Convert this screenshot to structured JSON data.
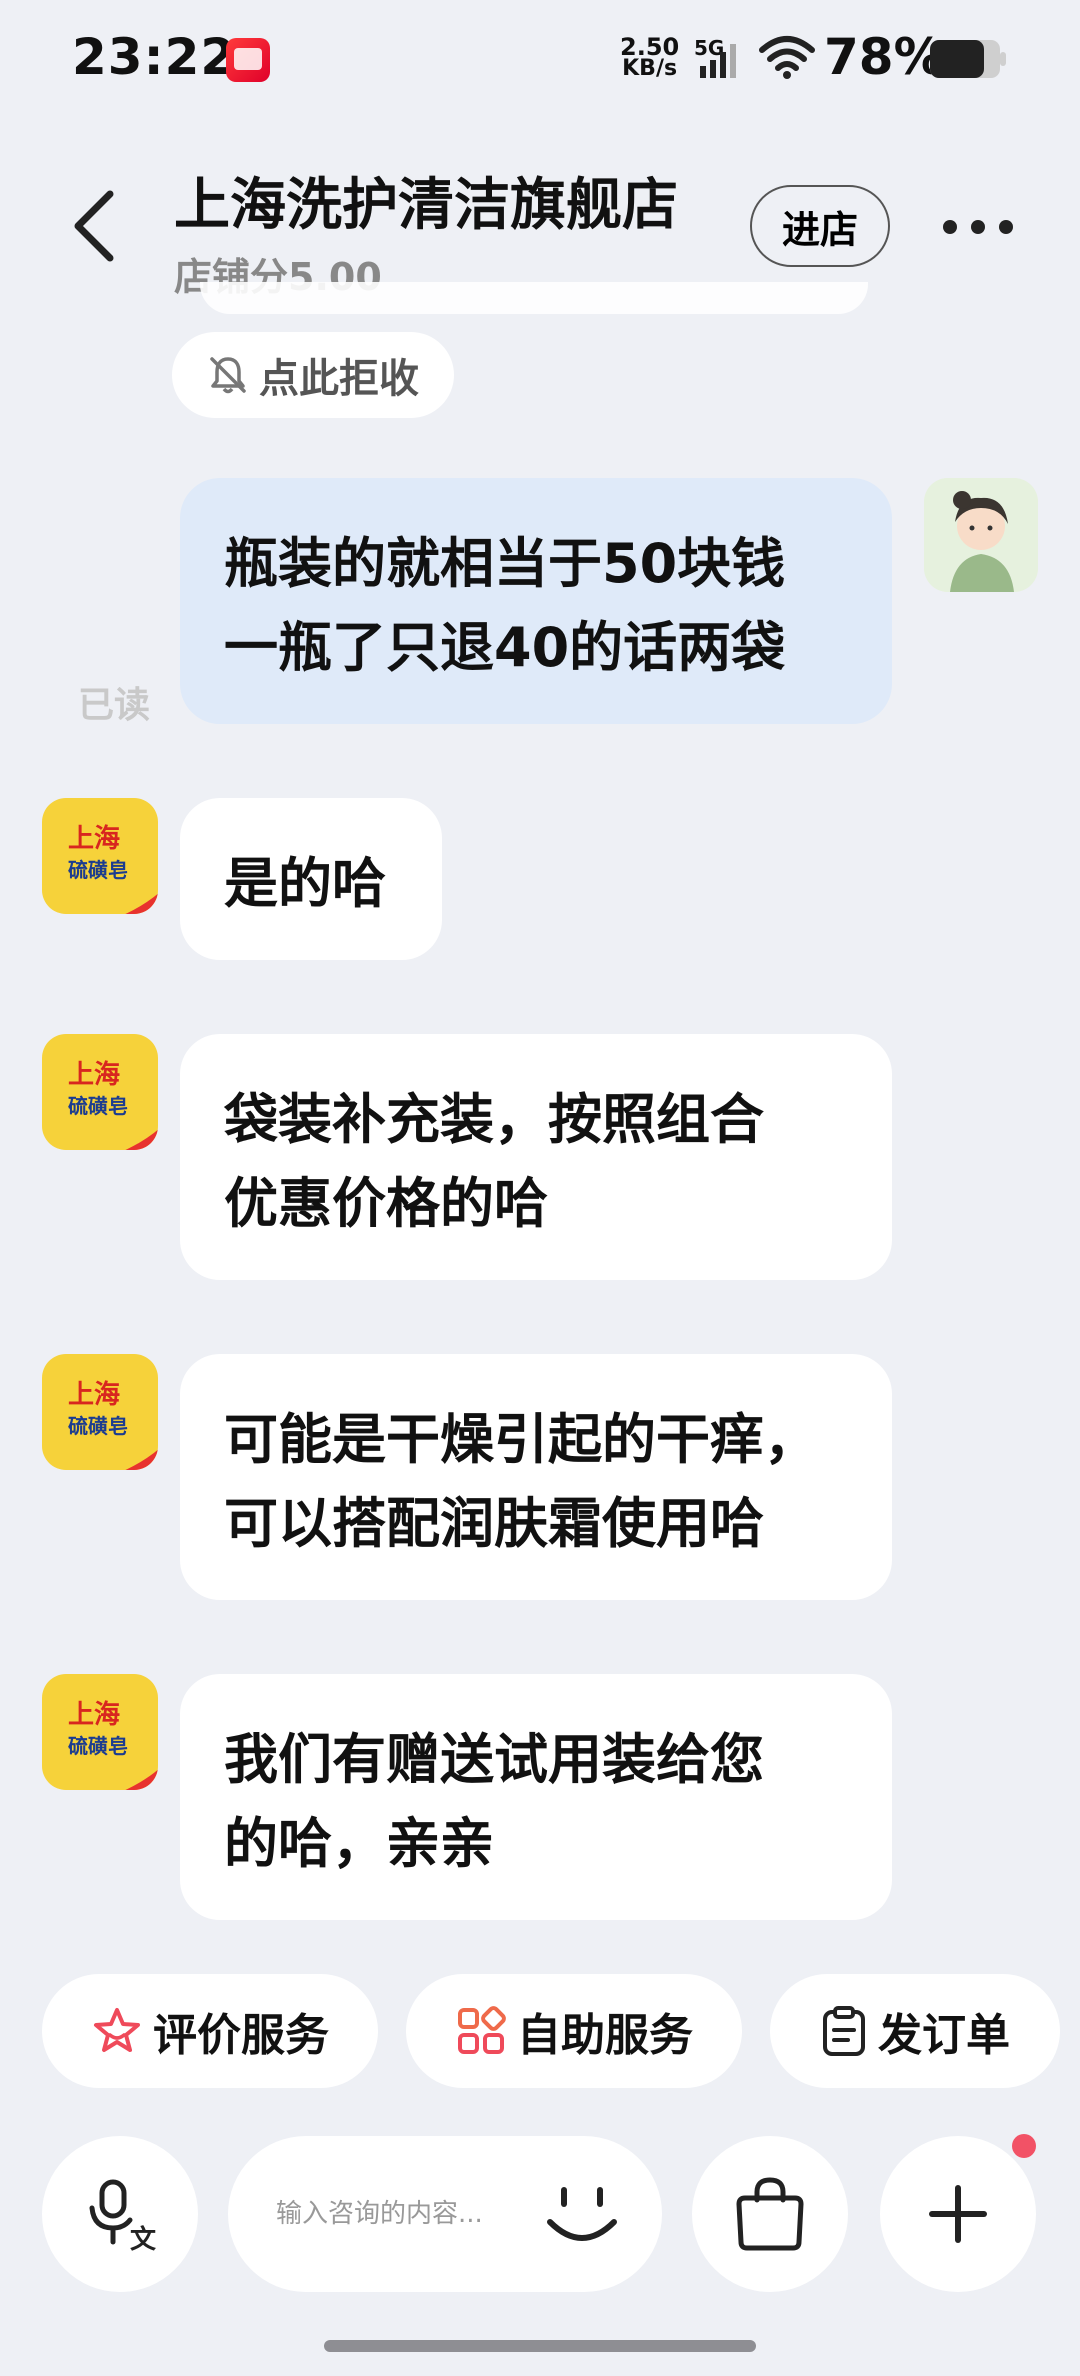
{
  "status_bar": {
    "time": "23:22",
    "net_speed_value": "2.50",
    "net_speed_unit": "KB/s",
    "network_type": "5G",
    "battery": "78%",
    "app_icon": "shopping-app-icon"
  },
  "header": {
    "title": "上海洗护清洁旗舰店",
    "score": "店铺分5.00",
    "enter_store_label": "进店",
    "back_icon": "chevron-left-icon",
    "more_icon": "more-dots-icon"
  },
  "notice": {
    "reject_label": "点此拒收",
    "icon": "bell-off-icon"
  },
  "messages": [
    {
      "from": "me",
      "lines": [
        "瓶装的就相当于50块钱",
        "一瓶了只退40的话两袋"
      ],
      "read_status": "已读"
    },
    {
      "from": "shop",
      "lines": [
        "是的哈"
      ]
    },
    {
      "from": "shop",
      "lines": [
        "袋装补充装，按照组合",
        "优惠价格的哈"
      ]
    },
    {
      "from": "shop",
      "lines": [
        "可能是干燥引起的干痒，",
        "可以搭配润肤霜使用哈"
      ]
    },
    {
      "from": "shop",
      "lines": [
        "我们有赠送试用装给您",
        "的哈，亲亲"
      ]
    }
  ],
  "shop_avatar": {
    "line1": "上海",
    "line2": "硫磺皂"
  },
  "quick_actions": [
    {
      "label": "评价服务",
      "icon": "star-outline-icon"
    },
    {
      "label": "自助服务",
      "icon": "grid-apps-icon"
    },
    {
      "label": "发订单",
      "icon": "clipboard-icon"
    }
  ],
  "input_bar": {
    "placeholder": "输入咨询的内容...",
    "voice_icon": "voice-translate-icon",
    "emoji_icon": "smile-icon",
    "bag_icon": "shopping-bag-icon",
    "plus_icon": "plus-icon"
  },
  "colors": {
    "background": "#eef0f5",
    "my_bubble": "#dfeaf9",
    "shop_bubble": "#ffffff",
    "accent_red": "#f25266"
  }
}
